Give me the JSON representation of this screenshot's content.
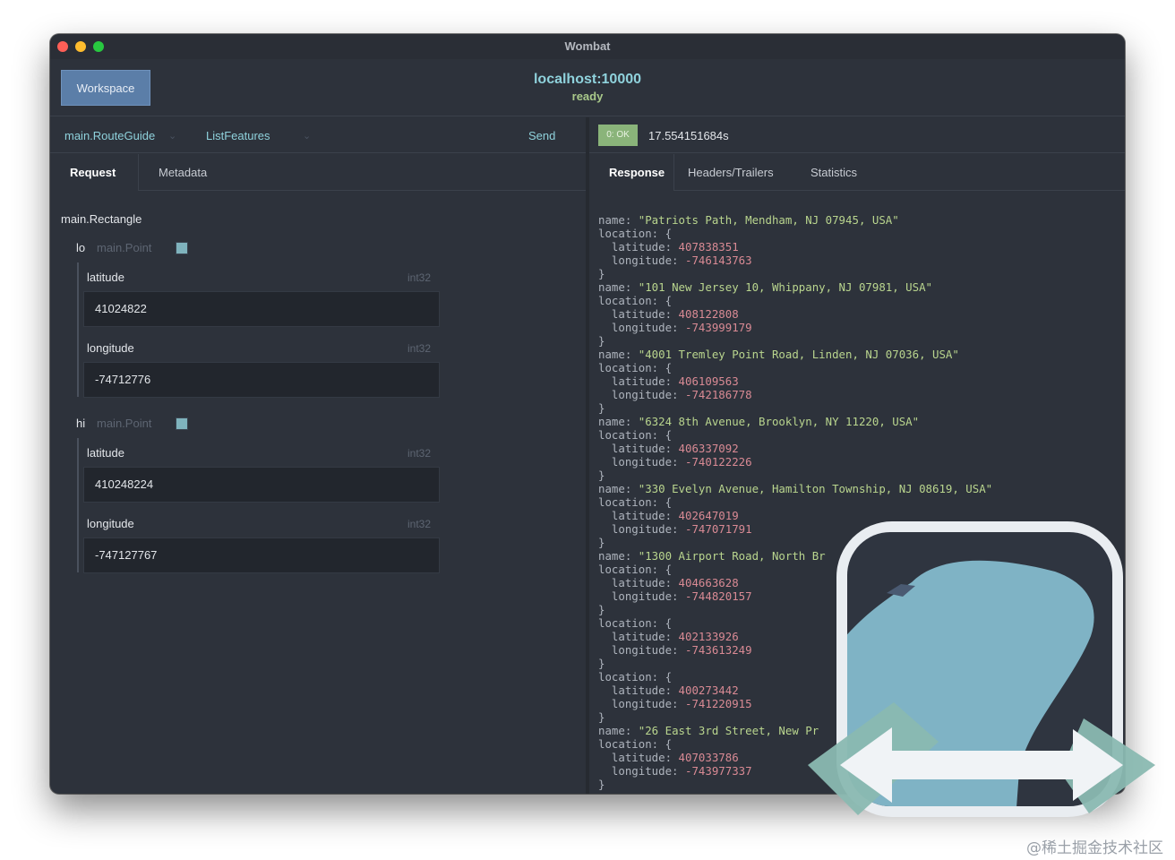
{
  "window": {
    "title": "Wombat"
  },
  "header": {
    "workspace_label": "Workspace",
    "host": "localhost:10000",
    "status": "ready"
  },
  "request": {
    "service": "main.RouteGuide",
    "method": "ListFeatures",
    "send_label": "Send",
    "tabs": [
      "Request",
      "Metadata"
    ],
    "message_type": "main.Rectangle",
    "fields": [
      {
        "key": "lo",
        "type": "main.Point",
        "subfields": [
          {
            "label": "latitude",
            "type": "int32",
            "value": "41024822"
          },
          {
            "label": "longitude",
            "type": "int32",
            "value": "-74712776"
          }
        ]
      },
      {
        "key": "hi",
        "type": "main.Point",
        "subfields": [
          {
            "label": "latitude",
            "type": "int32",
            "value": "410248224"
          },
          {
            "label": "longitude",
            "type": "int32",
            "value": "-747127767"
          }
        ]
      }
    ]
  },
  "response": {
    "status_badge": "0: OK",
    "elapsed": "17.554151684s",
    "tabs": [
      "Response",
      "Headers/Trailers",
      "Statistics"
    ],
    "lines": [
      [
        {
          "t": "k",
          "v": "name: "
        },
        {
          "t": "s",
          "v": "\"Patriots Path, Mendham, NJ 07945, USA\""
        }
      ],
      [
        {
          "t": "k",
          "v": "location: {"
        }
      ],
      [
        {
          "t": "k",
          "v": "  latitude: "
        },
        {
          "t": "n",
          "v": "407838351"
        }
      ],
      [
        {
          "t": "k",
          "v": "  longitude: "
        },
        {
          "t": "n",
          "v": "-746143763"
        }
      ],
      [
        {
          "t": "k",
          "v": "}"
        }
      ],
      [
        {
          "t": "k",
          "v": "name: "
        },
        {
          "t": "s",
          "v": "\"101 New Jersey 10, Whippany, NJ 07981, USA\""
        }
      ],
      [
        {
          "t": "k",
          "v": "location: {"
        }
      ],
      [
        {
          "t": "k",
          "v": "  latitude: "
        },
        {
          "t": "n",
          "v": "408122808"
        }
      ],
      [
        {
          "t": "k",
          "v": "  longitude: "
        },
        {
          "t": "n",
          "v": "-743999179"
        }
      ],
      [
        {
          "t": "k",
          "v": "}"
        }
      ],
      [
        {
          "t": "k",
          "v": "name: "
        },
        {
          "t": "s",
          "v": "\"4001 Tremley Point Road, Linden, NJ 07036, USA\""
        }
      ],
      [
        {
          "t": "k",
          "v": "location: {"
        }
      ],
      [
        {
          "t": "k",
          "v": "  latitude: "
        },
        {
          "t": "n",
          "v": "406109563"
        }
      ],
      [
        {
          "t": "k",
          "v": "  longitude: "
        },
        {
          "t": "n",
          "v": "-742186778"
        }
      ],
      [
        {
          "t": "k",
          "v": "}"
        }
      ],
      [
        {
          "t": "k",
          "v": "name: "
        },
        {
          "t": "s",
          "v": "\"6324 8th Avenue, Brooklyn, NY 11220, USA\""
        }
      ],
      [
        {
          "t": "k",
          "v": "location: {"
        }
      ],
      [
        {
          "t": "k",
          "v": "  latitude: "
        },
        {
          "t": "n",
          "v": "406337092"
        }
      ],
      [
        {
          "t": "k",
          "v": "  longitude: "
        },
        {
          "t": "n",
          "v": "-740122226"
        }
      ],
      [
        {
          "t": "k",
          "v": "}"
        }
      ],
      [
        {
          "t": "k",
          "v": "name: "
        },
        {
          "t": "s",
          "v": "\"330 Evelyn Avenue, Hamilton Township, NJ 08619, USA\""
        }
      ],
      [
        {
          "t": "k",
          "v": "location: {"
        }
      ],
      [
        {
          "t": "k",
          "v": "  latitude: "
        },
        {
          "t": "n",
          "v": "402647019"
        }
      ],
      [
        {
          "t": "k",
          "v": "  longitude: "
        },
        {
          "t": "n",
          "v": "-747071791"
        }
      ],
      [
        {
          "t": "k",
          "v": "}"
        }
      ],
      [
        {
          "t": "k",
          "v": "name: "
        },
        {
          "t": "s",
          "v": "\"1300 Airport Road, North Br"
        }
      ],
      [
        {
          "t": "k",
          "v": "location: {"
        }
      ],
      [
        {
          "t": "k",
          "v": "  latitude: "
        },
        {
          "t": "n",
          "v": "404663628"
        }
      ],
      [
        {
          "t": "k",
          "v": "  longitude: "
        },
        {
          "t": "n",
          "v": "-744820157"
        }
      ],
      [
        {
          "t": "k",
          "v": "}"
        }
      ],
      [
        {
          "t": "k",
          "v": "location: {"
        }
      ],
      [
        {
          "t": "k",
          "v": "  latitude: "
        },
        {
          "t": "n",
          "v": "402133926"
        }
      ],
      [
        {
          "t": "k",
          "v": "  longitude: "
        },
        {
          "t": "n",
          "v": "-743613249"
        }
      ],
      [
        {
          "t": "k",
          "v": "}"
        }
      ],
      [
        {
          "t": "k",
          "v": "location: {"
        }
      ],
      [
        {
          "t": "k",
          "v": "  latitude: "
        },
        {
          "t": "n",
          "v": "400273442"
        }
      ],
      [
        {
          "t": "k",
          "v": "  longitude: "
        },
        {
          "t": "n",
          "v": "-741220915"
        }
      ],
      [
        {
          "t": "k",
          "v": "}"
        }
      ],
      [
        {
          "t": "k",
          "v": "name: "
        },
        {
          "t": "s",
          "v": "\"26 East 3rd Street, New Pr"
        }
      ],
      [
        {
          "t": "k",
          "v": "location: {"
        }
      ],
      [
        {
          "t": "k",
          "v": "  latitude: "
        },
        {
          "t": "n",
          "v": "407033786"
        }
      ],
      [
        {
          "t": "k",
          "v": "  longitude: "
        },
        {
          "t": "n",
          "v": "-743977337"
        }
      ],
      [
        {
          "t": "k",
          "v": "}"
        }
      ]
    ]
  },
  "logo": {
    "icon": "wombat-app-icon"
  },
  "watermark": "@稀土掘金技术社区",
  "colors": {
    "accent": "#8fd2dc",
    "ok": "#8ab47a",
    "string": "#b9d58e",
    "number": "#d98a94",
    "workspace": "#5b7ea8"
  }
}
